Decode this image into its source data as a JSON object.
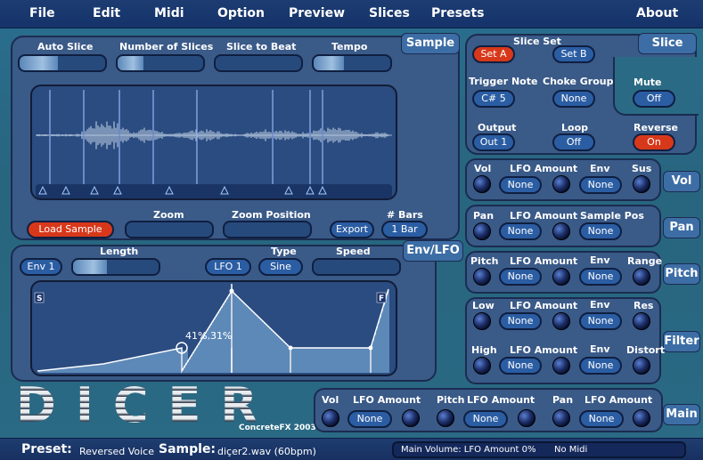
{
  "menu": [
    "File",
    "Edit",
    "Midi",
    "Option",
    "Preview",
    "Slices",
    "Presets",
    "About"
  ],
  "sample": {
    "tab": "Sample",
    "auto_slice": "Auto Slice",
    "number_of_slices": "Number of Slices",
    "slice_to_beat": "Slice to Beat",
    "tempo": "Tempo",
    "load_sample": "Load Sample",
    "zoom": "Zoom",
    "zoom_position": "Zoom Position",
    "export": "Export",
    "bars_label": "# Bars",
    "bars_value": "1 Bar"
  },
  "slice": {
    "tab": "Slice",
    "slice_set": "Slice Set",
    "set_a": "Set A",
    "set_b": "Set B",
    "trigger_note": "Trigger Note",
    "trigger_value": "C# 5",
    "choke_group": "Choke Group",
    "choke_value": "None",
    "mute": "Mute",
    "mute_value": "Off",
    "output": "Output",
    "output_value": "Out 1",
    "loop": "Loop",
    "loop_value": "Off",
    "reverse": "Reverse",
    "reverse_value": "On"
  },
  "vol": {
    "tab": "Vol",
    "vol": "Vol",
    "lfo_amount": "LFO Amount",
    "lfo_value": "None",
    "env": "Env",
    "env_value": "None",
    "sus": "Sus"
  },
  "pan": {
    "tab": "Pan",
    "pan": "Pan",
    "lfo_amount": "LFO Amount",
    "lfo_value": "None",
    "sample_pos": "Sample Pos",
    "sample_pos_value": "None"
  },
  "pitch": {
    "tab": "Pitch",
    "pitch": "Pitch",
    "lfo_amount": "LFO Amount",
    "lfo_value": "None",
    "env": "Env",
    "env_value": "None",
    "range": "Range"
  },
  "filter": {
    "tab": "Filter",
    "low": "Low",
    "lfo_amount_1": "LFO Amount",
    "lfo_value_1": "None",
    "env_1": "Env",
    "env_value_1": "None",
    "res": "Res",
    "high": "High",
    "lfo_amount_2": "LFO Amount",
    "lfo_value_2": "None",
    "env_2": "Env",
    "env_value_2": "None",
    "distort": "Distort"
  },
  "envlfo": {
    "tab": "Env/LFO",
    "env_select": "Env 1",
    "length": "Length",
    "lfo_select": "LFO 1",
    "type": "Type",
    "type_value": "Sine",
    "speed": "Speed",
    "start_marker": "S",
    "end_marker": "F",
    "readout": "41%,31%"
  },
  "main": {
    "tab": "Main",
    "vol": "Vol",
    "lfo_amount_1": "LFO Amount",
    "lfo_value_1": "None",
    "pitch": "Pitch",
    "lfo_amount_2": "LFO Amount",
    "lfo_value_2": "None",
    "pan": "Pan",
    "lfo_amount_3": "LFO Amount",
    "lfo_value_3": "None"
  },
  "logo": {
    "title": "DICER",
    "credit": "ConcreteFX 2003"
  },
  "status": {
    "preset_label": "Preset:",
    "preset_value": "Reversed Voice",
    "sample_label": "Sample:",
    "sample_value": "diçer2.wav (60bpm)",
    "info": "Main Volume: LFO Amount 0%",
    "midi": "No Midi"
  },
  "colors": {
    "accent_red": "#d8381a",
    "button_blue": "#2b5da3",
    "panel": "#3a5a88"
  }
}
